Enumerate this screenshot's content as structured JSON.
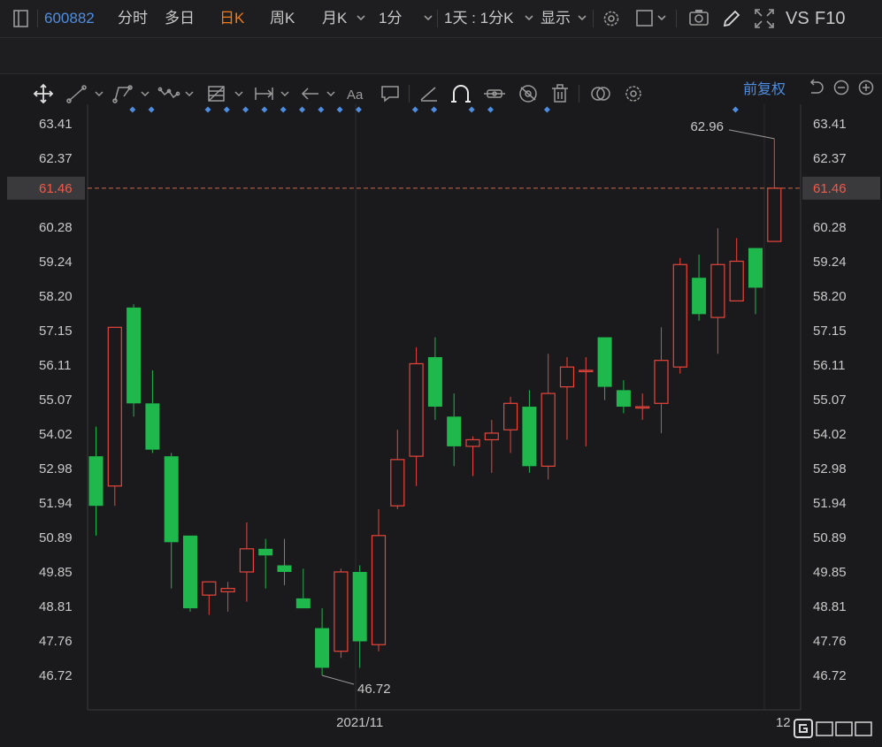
{
  "toolbar": {
    "stock_code": "600882",
    "tabs": [
      "分时",
      "多日",
      "日K",
      "周K",
      "月K",
      "1分"
    ],
    "active_tab": "日K",
    "period_select": "1天 : 1分K",
    "display_label": "显示",
    "vs_label": "VS",
    "f10_label": "F10"
  },
  "chart_header": {
    "adjust_label": "前复权"
  },
  "chart_data": {
    "type": "candlestick",
    "y_ticks": [
      "63.41",
      "62.37",
      "61.46",
      "60.28",
      "59.24",
      "58.20",
      "57.15",
      "56.11",
      "55.07",
      "54.02",
      "52.98",
      "51.94",
      "50.89",
      "49.85",
      "48.81",
      "47.76",
      "46.72"
    ],
    "current_price": "61.46",
    "x_labels": [
      {
        "label": "2021/11",
        "index": 14
      },
      {
        "label": "12",
        "index": 36
      }
    ],
    "max_label": "62.96",
    "min_label": "46.72",
    "up_color": "#e8453c",
    "down_color": "#1fb84d",
    "event_marker_indices": [
      1,
      2,
      5,
      6,
      7,
      8,
      9,
      10,
      11,
      12,
      13,
      16,
      17,
      19,
      20,
      23,
      33
    ],
    "candles": [
      {
        "o": 53.35,
        "h": 54.25,
        "l": 50.95,
        "c": 51.85
      },
      {
        "o": 52.45,
        "h": 57.25,
        "l": 51.85,
        "c": 57.25
      },
      {
        "o": 57.85,
        "h": 57.95,
        "l": 54.55,
        "c": 54.95
      },
      {
        "o": 54.95,
        "h": 55.95,
        "l": 53.45,
        "c": 53.55
      },
      {
        "o": 53.35,
        "h": 53.45,
        "l": 49.35,
        "c": 50.75
      },
      {
        "o": 50.95,
        "h": 50.95,
        "l": 48.65,
        "c": 48.75
      },
      {
        "o": 49.15,
        "h": 49.45,
        "l": 48.55,
        "c": 49.55
      },
      {
        "o": 49.25,
        "h": 49.55,
        "l": 48.65,
        "c": 49.35
      },
      {
        "o": 49.85,
        "h": 51.35,
        "l": 48.95,
        "c": 50.55
      },
      {
        "o": 50.55,
        "h": 50.85,
        "l": 49.35,
        "c": 50.35
      },
      {
        "o": 50.05,
        "h": 50.85,
        "l": 49.45,
        "c": 49.85
      },
      {
        "o": 49.05,
        "h": 49.95,
        "l": 48.75,
        "c": 48.75
      },
      {
        "o": 48.15,
        "h": 48.75,
        "l": 46.72,
        "c": 46.95
      },
      {
        "o": 47.45,
        "h": 49.95,
        "l": 47.25,
        "c": 49.85
      },
      {
        "o": 49.85,
        "h": 50.05,
        "l": 46.95,
        "c": 47.75
      },
      {
        "o": 47.65,
        "h": 51.75,
        "l": 47.45,
        "c": 50.95
      },
      {
        "o": 51.85,
        "h": 54.15,
        "l": 51.75,
        "c": 53.25
      },
      {
        "o": 53.35,
        "h": 56.65,
        "l": 52.45,
        "c": 56.15
      },
      {
        "o": 56.35,
        "h": 56.95,
        "l": 54.45,
        "c": 54.85
      },
      {
        "o": 54.55,
        "h": 55.25,
        "l": 53.05,
        "c": 53.65
      },
      {
        "o": 53.65,
        "h": 53.95,
        "l": 52.75,
        "c": 53.85
      },
      {
        "o": 53.85,
        "h": 54.45,
        "l": 52.85,
        "c": 54.05
      },
      {
        "o": 54.15,
        "h": 55.15,
        "l": 53.45,
        "c": 54.95
      },
      {
        "o": 54.85,
        "h": 55.35,
        "l": 52.85,
        "c": 53.05
      },
      {
        "o": 53.05,
        "h": 56.45,
        "l": 52.65,
        "c": 55.25
      },
      {
        "o": 55.45,
        "h": 56.35,
        "l": 53.85,
        "c": 56.05
      },
      {
        "o": 55.95,
        "h": 56.35,
        "l": 53.65,
        "c": 55.95
      },
      {
        "o": 56.95,
        "h": 56.95,
        "l": 55.05,
        "c": 55.45
      },
      {
        "o": 55.35,
        "h": 55.65,
        "l": 54.65,
        "c": 54.85
      },
      {
        "o": 54.85,
        "h": 55.25,
        "l": 54.45,
        "c": 54.85
      },
      {
        "o": 54.95,
        "h": 57.25,
        "l": 54.05,
        "c": 56.25
      },
      {
        "o": 56.05,
        "h": 59.35,
        "l": 55.85,
        "c": 59.15
      },
      {
        "o": 58.75,
        "h": 59.45,
        "l": 57.45,
        "c": 57.65
      },
      {
        "o": 57.55,
        "h": 60.25,
        "l": 56.45,
        "c": 59.15
      },
      {
        "o": 58.05,
        "h": 59.95,
        "l": 58.05,
        "c": 59.25
      },
      {
        "o": 59.65,
        "h": 59.65,
        "l": 57.65,
        "c": 58.45
      },
      {
        "o": 59.85,
        "h": 62.96,
        "l": 59.85,
        "c": 61.46
      }
    ]
  }
}
